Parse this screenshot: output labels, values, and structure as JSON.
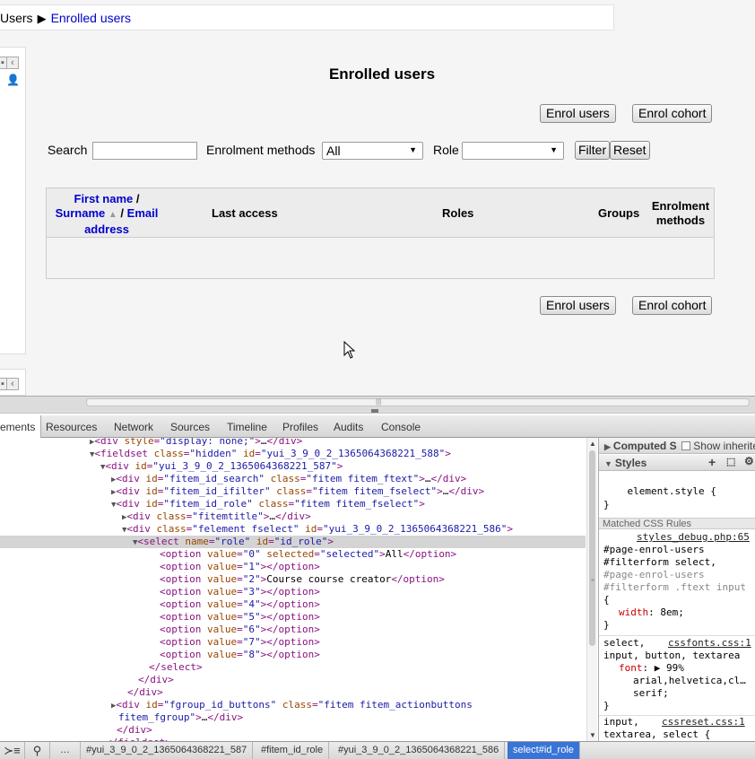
{
  "breadcrumb": {
    "parent": "Users",
    "separator": "▶",
    "current": "Enrolled users"
  },
  "page": {
    "title": "Enrolled users",
    "enrol_users_label": "Enrol users",
    "enrol_cohort_label": "Enrol cohort"
  },
  "filter": {
    "search_label": "Search",
    "search_value": "",
    "methods_label": "Enrolment methods",
    "methods_selected": "All",
    "role_label": "Role",
    "role_selected": "",
    "filter_button": "Filter",
    "reset_button": "Reset"
  },
  "table": {
    "col_firstname": "First name",
    "col_sep": "/",
    "col_surname": "Surname",
    "col_email": "Email",
    "col_address": "address",
    "col_last_access": "Last access",
    "col_roles": "Roles",
    "col_groups": "Groups",
    "col_enrol_1": "Enrolment",
    "col_enrol_2": "methods"
  },
  "devtools": {
    "tabs": [
      "ements",
      "Resources",
      "Network",
      "Sources",
      "Timeline",
      "Profiles",
      "Audits",
      "Console"
    ],
    "dom": [
      {
        "t": "▶",
        "ind": 110,
        "parts": [
          [
            "tag",
            "<div "
          ],
          [
            "an",
            "style"
          ],
          [
            "tag",
            "="
          ],
          [
            "av",
            "\"display: none;\""
          ],
          [
            "tag",
            ">"
          ],
          [
            "tx",
            "…"
          ],
          [
            "tag",
            "</div>"
          ]
        ]
      },
      {
        "t": "▼",
        "ind": 110,
        "parts": [
          [
            "tag",
            "<fieldset "
          ],
          [
            "an",
            "class"
          ],
          [
            "tag",
            "="
          ],
          [
            "av",
            "\"hidden\""
          ],
          [
            "tag",
            " "
          ],
          [
            "an",
            "id"
          ],
          [
            "tag",
            "="
          ],
          [
            "av",
            "\"yui_3_9_0_2_1365064368221_588\""
          ],
          [
            "tag",
            ">"
          ]
        ]
      },
      {
        "t": "▼",
        "ind": 122,
        "parts": [
          [
            "tag",
            "<div "
          ],
          [
            "an",
            "id"
          ],
          [
            "tag",
            "="
          ],
          [
            "av",
            "\"yui_3_9_0_2_1365064368221_587\""
          ],
          [
            "tag",
            ">"
          ]
        ]
      },
      {
        "t": "▶",
        "ind": 134,
        "parts": [
          [
            "tag",
            "<div "
          ],
          [
            "an",
            "id"
          ],
          [
            "tag",
            "="
          ],
          [
            "av",
            "\"fitem_id_search\""
          ],
          [
            "tag",
            " "
          ],
          [
            "an",
            "class"
          ],
          [
            "tag",
            "="
          ],
          [
            "av",
            "\"fitem fitem_ftext\""
          ],
          [
            "tag",
            ">"
          ],
          [
            "tx",
            "…"
          ],
          [
            "tag",
            "</div>"
          ]
        ]
      },
      {
        "t": "▶",
        "ind": 134,
        "parts": [
          [
            "tag",
            "<div "
          ],
          [
            "an",
            "id"
          ],
          [
            "tag",
            "="
          ],
          [
            "av",
            "\"fitem_id_ifilter\""
          ],
          [
            "tag",
            " "
          ],
          [
            "an",
            "class"
          ],
          [
            "tag",
            "="
          ],
          [
            "av",
            "\"fitem fitem_fselect\""
          ],
          [
            "tag",
            ">"
          ],
          [
            "tx",
            "…"
          ],
          [
            "tag",
            "</div>"
          ]
        ]
      },
      {
        "t": "▼",
        "ind": 134,
        "parts": [
          [
            "tag",
            "<div "
          ],
          [
            "an",
            "id"
          ],
          [
            "tag",
            "="
          ],
          [
            "av",
            "\"fitem_id_role\""
          ],
          [
            "tag",
            " "
          ],
          [
            "an",
            "class"
          ],
          [
            "tag",
            "="
          ],
          [
            "av",
            "\"fitem fitem_fselect\""
          ],
          [
            "tag",
            ">"
          ]
        ]
      },
      {
        "t": "▶",
        "ind": 146,
        "parts": [
          [
            "tag",
            "<div "
          ],
          [
            "an",
            "class"
          ],
          [
            "tag",
            "="
          ],
          [
            "av",
            "\"fitemtitle\""
          ],
          [
            "tag",
            ">"
          ],
          [
            "tx",
            "…"
          ],
          [
            "tag",
            "</div>"
          ]
        ]
      },
      {
        "t": "▼",
        "ind": 146,
        "parts": [
          [
            "tag",
            "<div "
          ],
          [
            "an",
            "class"
          ],
          [
            "tag",
            "="
          ],
          [
            "av",
            "\"felement fselect\""
          ],
          [
            "tag",
            " "
          ],
          [
            "an",
            "id"
          ],
          [
            "tag",
            "="
          ],
          [
            "av",
            "\"yui_3_9_0_2_1365064368221_586\""
          ],
          [
            "tag",
            ">"
          ]
        ]
      },
      {
        "t": "▼",
        "ind": 158,
        "sel": true,
        "parts": [
          [
            "tag",
            "<select "
          ],
          [
            "an",
            "name"
          ],
          [
            "tag",
            "="
          ],
          [
            "av",
            "\"role\""
          ],
          [
            "tag",
            " "
          ],
          [
            "an",
            "id"
          ],
          [
            "tag",
            "="
          ],
          [
            "av",
            "\"id_role\""
          ],
          [
            "tag",
            ">"
          ]
        ]
      },
      {
        "t": "",
        "ind": 178,
        "parts": [
          [
            "tag",
            "<option "
          ],
          [
            "an",
            "value"
          ],
          [
            "tag",
            "="
          ],
          [
            "av",
            "\"0\""
          ],
          [
            "tag",
            " "
          ],
          [
            "an",
            "selected"
          ],
          [
            "tag",
            "="
          ],
          [
            "av",
            "\"selected\""
          ],
          [
            "tag",
            ">"
          ],
          [
            "tx",
            "All"
          ],
          [
            "tag",
            "</option>"
          ]
        ]
      },
      {
        "t": "",
        "ind": 178,
        "parts": [
          [
            "tag",
            "<option "
          ],
          [
            "an",
            "value"
          ],
          [
            "tag",
            "="
          ],
          [
            "av",
            "\"1\""
          ],
          [
            "tag",
            "></option>"
          ]
        ]
      },
      {
        "t": "",
        "ind": 178,
        "parts": [
          [
            "tag",
            "<option "
          ],
          [
            "an",
            "value"
          ],
          [
            "tag",
            "="
          ],
          [
            "av",
            "\"2\""
          ],
          [
            "tag",
            ">"
          ],
          [
            "tx",
            "Course course creator"
          ],
          [
            "tag",
            "</option>"
          ]
        ]
      },
      {
        "t": "",
        "ind": 178,
        "parts": [
          [
            "tag",
            "<option "
          ],
          [
            "an",
            "value"
          ],
          [
            "tag",
            "="
          ],
          [
            "av",
            "\"3\""
          ],
          [
            "tag",
            "></option>"
          ]
        ]
      },
      {
        "t": "",
        "ind": 178,
        "parts": [
          [
            "tag",
            "<option "
          ],
          [
            "an",
            "value"
          ],
          [
            "tag",
            "="
          ],
          [
            "av",
            "\"4\""
          ],
          [
            "tag",
            "></option>"
          ]
        ]
      },
      {
        "t": "",
        "ind": 178,
        "parts": [
          [
            "tag",
            "<option "
          ],
          [
            "an",
            "value"
          ],
          [
            "tag",
            "="
          ],
          [
            "av",
            "\"5\""
          ],
          [
            "tag",
            "></option>"
          ]
        ]
      },
      {
        "t": "",
        "ind": 178,
        "parts": [
          [
            "tag",
            "<option "
          ],
          [
            "an",
            "value"
          ],
          [
            "tag",
            "="
          ],
          [
            "av",
            "\"6\""
          ],
          [
            "tag",
            "></option>"
          ]
        ]
      },
      {
        "t": "",
        "ind": 178,
        "parts": [
          [
            "tag",
            "<option "
          ],
          [
            "an",
            "value"
          ],
          [
            "tag",
            "="
          ],
          [
            "av",
            "\"7\""
          ],
          [
            "tag",
            "></option>"
          ]
        ]
      },
      {
        "t": "",
        "ind": 178,
        "parts": [
          [
            "tag",
            "<option "
          ],
          [
            "an",
            "value"
          ],
          [
            "tag",
            "="
          ],
          [
            "av",
            "\"8\""
          ],
          [
            "tag",
            "></option>"
          ]
        ]
      },
      {
        "t": "",
        "ind": 166,
        "parts": [
          [
            "tag",
            "</select>"
          ]
        ]
      },
      {
        "t": "",
        "ind": 154,
        "parts": [
          [
            "tag",
            "</div>"
          ]
        ]
      },
      {
        "t": "",
        "ind": 142,
        "parts": [
          [
            "tag",
            "</div>"
          ]
        ]
      },
      {
        "t": "▶",
        "ind": 134,
        "parts": [
          [
            "tag",
            "<div "
          ],
          [
            "an",
            "id"
          ],
          [
            "tag",
            "="
          ],
          [
            "av",
            "\"fgroup_id_buttons\""
          ],
          [
            "tag",
            " "
          ],
          [
            "an",
            "class"
          ],
          [
            "tag",
            "="
          ],
          [
            "av",
            "\"fitem fitem_actionbuttons"
          ]
        ]
      },
      {
        "t": "",
        "ind": 132,
        "parts": [
          [
            "av",
            "fitem_fgroup\""
          ],
          [
            "tag",
            ">"
          ],
          [
            "tx",
            "…"
          ],
          [
            "tag",
            "</div>"
          ]
        ]
      },
      {
        "t": "",
        "ind": 130,
        "parts": [
          [
            "tag",
            "</div>"
          ]
        ]
      },
      {
        "t": "",
        "ind": 118,
        "parts": [
          [
            "tag",
            "</fieldset>"
          ]
        ]
      }
    ],
    "sidebar": {
      "computed_header": "Computed S",
      "show_inherited": "Show inherite",
      "styles_header": "Styles",
      "element_style_open": "element.style {",
      "element_style_close": "}",
      "matched_header": "Matched CSS Rules",
      "rule1_source": "styles_debug.php:65",
      "rule1_sel1": "#page-enrol-users",
      "rule1_sel2": "#filterform select,",
      "rule1_sel3": "#page-enrol-users",
      "rule1_sel4": "#filterform .ftext input",
      "rule1_open": "{",
      "rule1_prop": "width",
      "rule1_val": ": 8em;",
      "rule1_close": "}",
      "rule2_sel1": "select,",
      "rule2_source": "cssfonts.css:1",
      "rule2_sel2": "input, button, textarea",
      "rule2_prop": "font",
      "rule2_val": ": ▶ 99%",
      "rule2_val2": "arial,helvetica,cl…",
      "rule2_val3": "serif;",
      "rule2_close": "}",
      "rule3_sel1": "input,",
      "rule3_source": "cssreset.css:1",
      "rule3_sel2": "textarea, select {"
    },
    "status": {
      "crumbs": [
        "#yui_3_9_0_2_1365064368221_587",
        "#fitem_id_role",
        "#yui_3_9_0_2_1365064368221_586",
        "select#id_role"
      ]
    }
  }
}
